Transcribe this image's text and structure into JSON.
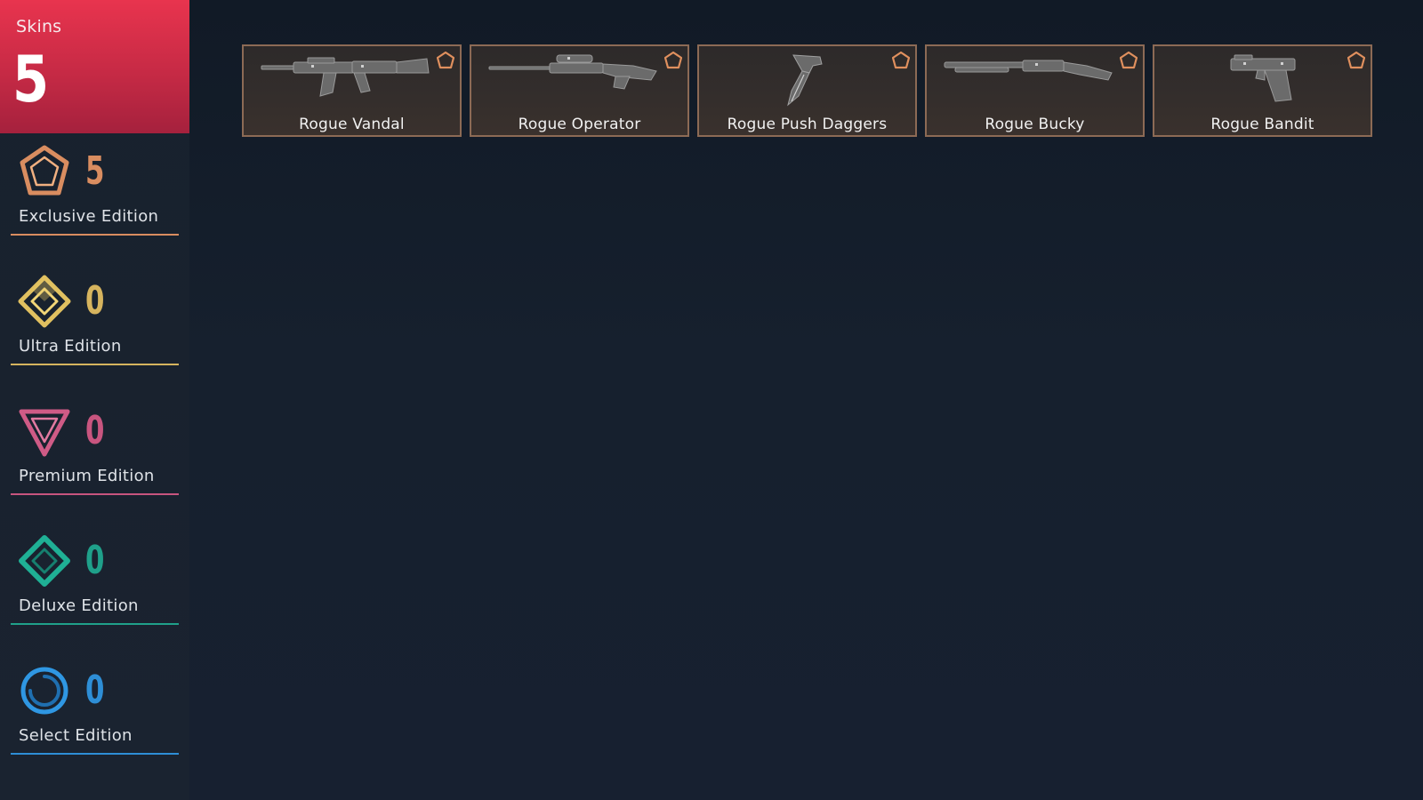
{
  "header": {
    "label": "Skins",
    "count": "5",
    "color": "#d42f48"
  },
  "editions": [
    {
      "name": "Exclusive Edition",
      "count": "5",
      "color": "#d98d60",
      "icon": "exclusive-edition-icon"
    },
    {
      "name": "Ultra Edition",
      "count": "0",
      "color": "#d6b45e",
      "icon": "ultra-edition-icon"
    },
    {
      "name": "Premium Edition",
      "count": "0",
      "color": "#c8557f",
      "icon": "premium-edition-icon"
    },
    {
      "name": "Deluxe Edition",
      "count": "0",
      "color": "#1fa08a",
      "icon": "deluxe-edition-icon"
    },
    {
      "name": "Select Edition",
      "count": "0",
      "color": "#2e8ed6",
      "icon": "select-edition-icon"
    }
  ],
  "skins": [
    {
      "name": "Rogue Vandal",
      "weapon": "rifle-icon",
      "tier": "exclusive-edition-icon"
    },
    {
      "name": "Rogue Operator",
      "weapon": "sniper-rifle-icon",
      "tier": "exclusive-edition-icon"
    },
    {
      "name": "Rogue Push Daggers",
      "weapon": "push-dagger-icon",
      "tier": "exclusive-edition-icon"
    },
    {
      "name": "Rogue Bucky",
      "weapon": "shotgun-icon",
      "tier": "exclusive-edition-icon"
    },
    {
      "name": "Rogue Bandit",
      "weapon": "pistol-icon",
      "tier": "exclusive-edition-icon"
    }
  ]
}
